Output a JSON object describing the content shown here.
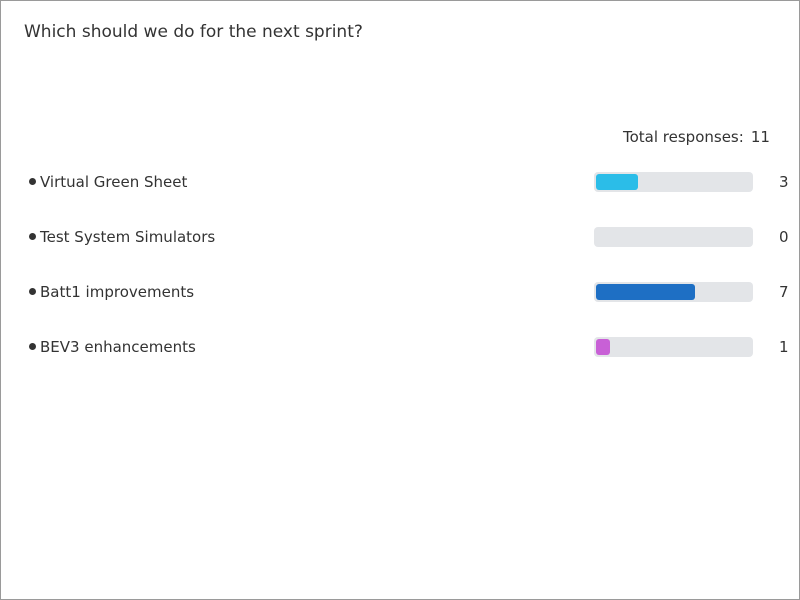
{
  "poll": {
    "question": "Which should we do for the next sprint?",
    "total_label": "Total responses:",
    "total_count": "11",
    "options": [
      {
        "label": "Virtual Green Sheet",
        "count": "3",
        "votes": 3,
        "color": "#2bbde8"
      },
      {
        "label": "Test System Simulators",
        "count": "0",
        "votes": 0,
        "color": "#2bbde8"
      },
      {
        "label": "Batt1 improvements",
        "count": "7",
        "votes": 7,
        "color": "#1e6fc4"
      },
      {
        "label": "BEV3 enhancements",
        "count": "1",
        "votes": 1,
        "color": "#c860d6"
      }
    ]
  }
}
